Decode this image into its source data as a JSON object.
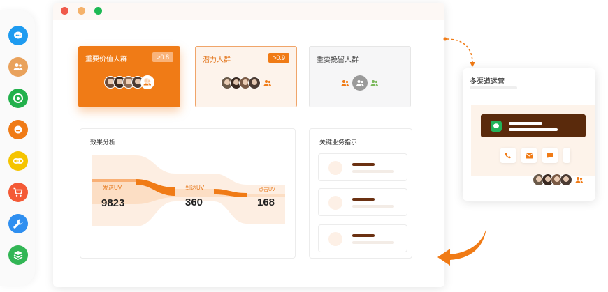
{
  "colors": {
    "accent": "#f07b16",
    "dark_brown": "#5a2a0c",
    "light_orange": "#fdeee2",
    "rail_icons": [
      "#1e9bf0",
      "#e9a25c",
      "#22b14c",
      "#f07b16",
      "#f5c400",
      "#f45a36",
      "#2f8ff0",
      "#32b655"
    ]
  },
  "rail": {
    "icons": [
      "chat-bubble-icon",
      "users-icon",
      "shutter-icon",
      "message-icon",
      "link-icon",
      "cart-icon",
      "wrench-icon",
      "layers-icon"
    ]
  },
  "window": {
    "dots": [
      "#f05a4b",
      "#f5b26b",
      "#1db954"
    ]
  },
  "segments": [
    {
      "title": "重要价值人群",
      "badge": ">0.8",
      "style": "filled"
    },
    {
      "title": "潜力人群",
      "badge": ">0.9",
      "style": "outlined"
    },
    {
      "title": "重要挽留人群",
      "badge": "",
      "style": "gray"
    }
  ],
  "effect": {
    "title": "效果分析",
    "stages": [
      {
        "label": "发送UV",
        "value": "9823"
      },
      {
        "label": "到达UV",
        "value": "360"
      },
      {
        "label": "点击UV",
        "value": "168"
      }
    ]
  },
  "kpi": {
    "title": "关键业务指示"
  },
  "channel": {
    "title": "多渠道运营",
    "icons": [
      "phone-icon",
      "mail-icon",
      "sms-icon"
    ]
  }
}
